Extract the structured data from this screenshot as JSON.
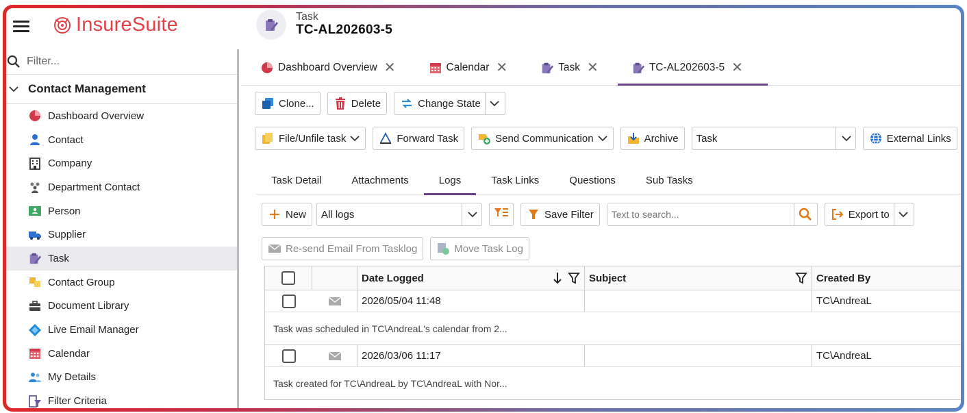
{
  "app": {
    "name_part1": "Insure",
    "name_part2": "Suite",
    "accent": "#e0424a"
  },
  "header": {
    "record_type": "Task",
    "record_id": "TC-AL202603-5"
  },
  "sidebar": {
    "filter_placeholder": "Filter...",
    "section_title": "Contact Management",
    "items": [
      {
        "label": "Dashboard Overview",
        "icon": "pie-chart-icon"
      },
      {
        "label": "Contact",
        "icon": "person-icon"
      },
      {
        "label": "Company",
        "icon": "building-icon"
      },
      {
        "label": "Department Contact",
        "icon": "people-icon"
      },
      {
        "label": "Person",
        "icon": "id-card-icon"
      },
      {
        "label": "Supplier",
        "icon": "truck-icon"
      },
      {
        "label": "Task",
        "icon": "task-pencil-icon",
        "active": true
      },
      {
        "label": "Contact Group",
        "icon": "group-icon"
      },
      {
        "label": "Document Library",
        "icon": "briefcase-icon"
      },
      {
        "label": "Live Email Manager",
        "icon": "email-manager-icon"
      },
      {
        "label": "Calendar",
        "icon": "calendar-icon"
      },
      {
        "label": "My Details",
        "icon": "my-details-icon"
      },
      {
        "label": "Filter Criteria",
        "icon": "filter-criteria-icon"
      }
    ]
  },
  "doc_tabs": [
    {
      "label": "Dashboard Overview",
      "icon": "pie-chart-icon"
    },
    {
      "label": "Calendar",
      "icon": "calendar-icon"
    },
    {
      "label": "Task",
      "icon": "task-pencil-icon"
    },
    {
      "label": "TC-AL202603-5",
      "icon": "task-pencil-icon",
      "active": true
    }
  ],
  "toolbar1": {
    "clone": "Clone...",
    "delete": "Delete",
    "change_state": "Change State"
  },
  "toolbar2": {
    "file_unfile": "File/Unfile task",
    "forward": "Forward Task",
    "send_comm": "Send Communication",
    "archive": "Archive",
    "type_select": "Task",
    "external_links": "External Links"
  },
  "subtabs": [
    "Task Detail",
    "Attachments",
    "Logs",
    "Task Links",
    "Questions",
    "Sub Tasks"
  ],
  "active_subtab": "Logs",
  "logs_toolbar": {
    "new": "New",
    "log_filter": "All logs",
    "save_filter": "Save Filter",
    "search_placeholder": "Text to search...",
    "export": "Export to",
    "resend": "Re-send Email From Tasklog",
    "move": "Move Task Log"
  },
  "grid": {
    "columns": [
      "Date Logged",
      "Subject",
      "Created By"
    ],
    "rows": [
      {
        "date": "2026/05/04 11:48",
        "subject": "",
        "created_by": "TC\\AndreaL",
        "detail": "Task was scheduled in TC\\AndreaL's calendar from 2..."
      },
      {
        "date": "2026/03/06 11:17",
        "subject": "",
        "created_by": "TC\\AndreaL",
        "detail": "Task created for TC\\AndreaL by TC\\AndreaL with Nor..."
      }
    ]
  }
}
